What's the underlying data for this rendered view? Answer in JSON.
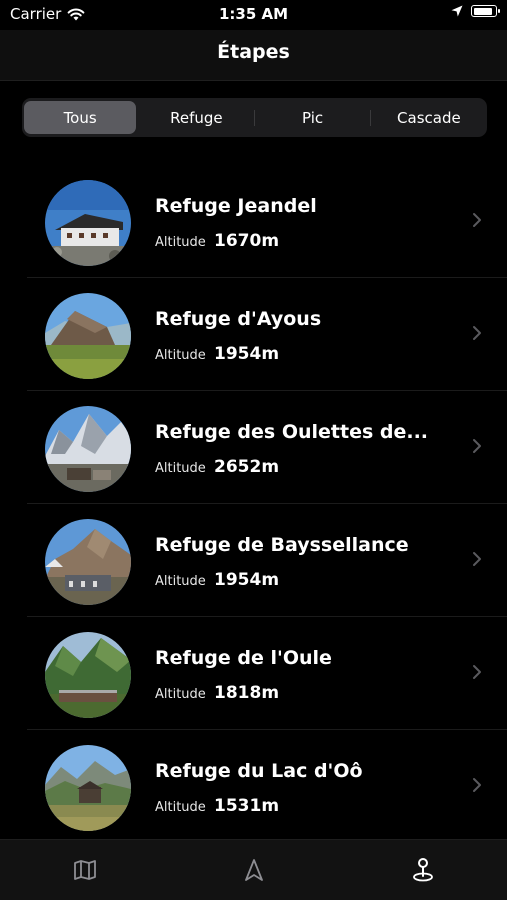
{
  "status_bar": {
    "carrier": "Carrier",
    "time": "1:35 AM"
  },
  "nav": {
    "title": "Étapes"
  },
  "segments": [
    {
      "label": "Tous",
      "selected": true
    },
    {
      "label": "Refuge",
      "selected": false
    },
    {
      "label": "Pic",
      "selected": false
    },
    {
      "label": "Cascade",
      "selected": false
    }
  ],
  "list": [
    {
      "name": "Refuge Jeandel",
      "altitude_label": "Altitude",
      "altitude": "1670m"
    },
    {
      "name": "Refuge d'Ayous",
      "altitude_label": "Altitude",
      "altitude": "1954m"
    },
    {
      "name": "Refuge des Oulettes de...",
      "altitude_label": "Altitude",
      "altitude": "2652m"
    },
    {
      "name": "Refuge de Bayssellance",
      "altitude_label": "Altitude",
      "altitude": "1954m"
    },
    {
      "name": "Refuge de l'Oule",
      "altitude_label": "Altitude",
      "altitude": "1818m"
    },
    {
      "name": "Refuge du Lac d'Oô",
      "altitude_label": "Altitude",
      "altitude": "1531m"
    }
  ],
  "tabs": [
    {
      "icon": "map-icon"
    },
    {
      "icon": "navigation-arrow-icon"
    },
    {
      "icon": "location-pin-icon",
      "selected": true
    }
  ],
  "colors": {
    "background": "#000000",
    "segment_selected": "#5b5b60",
    "chevron": "#5a5a5e",
    "tab_inactive": "#8e8e93"
  }
}
